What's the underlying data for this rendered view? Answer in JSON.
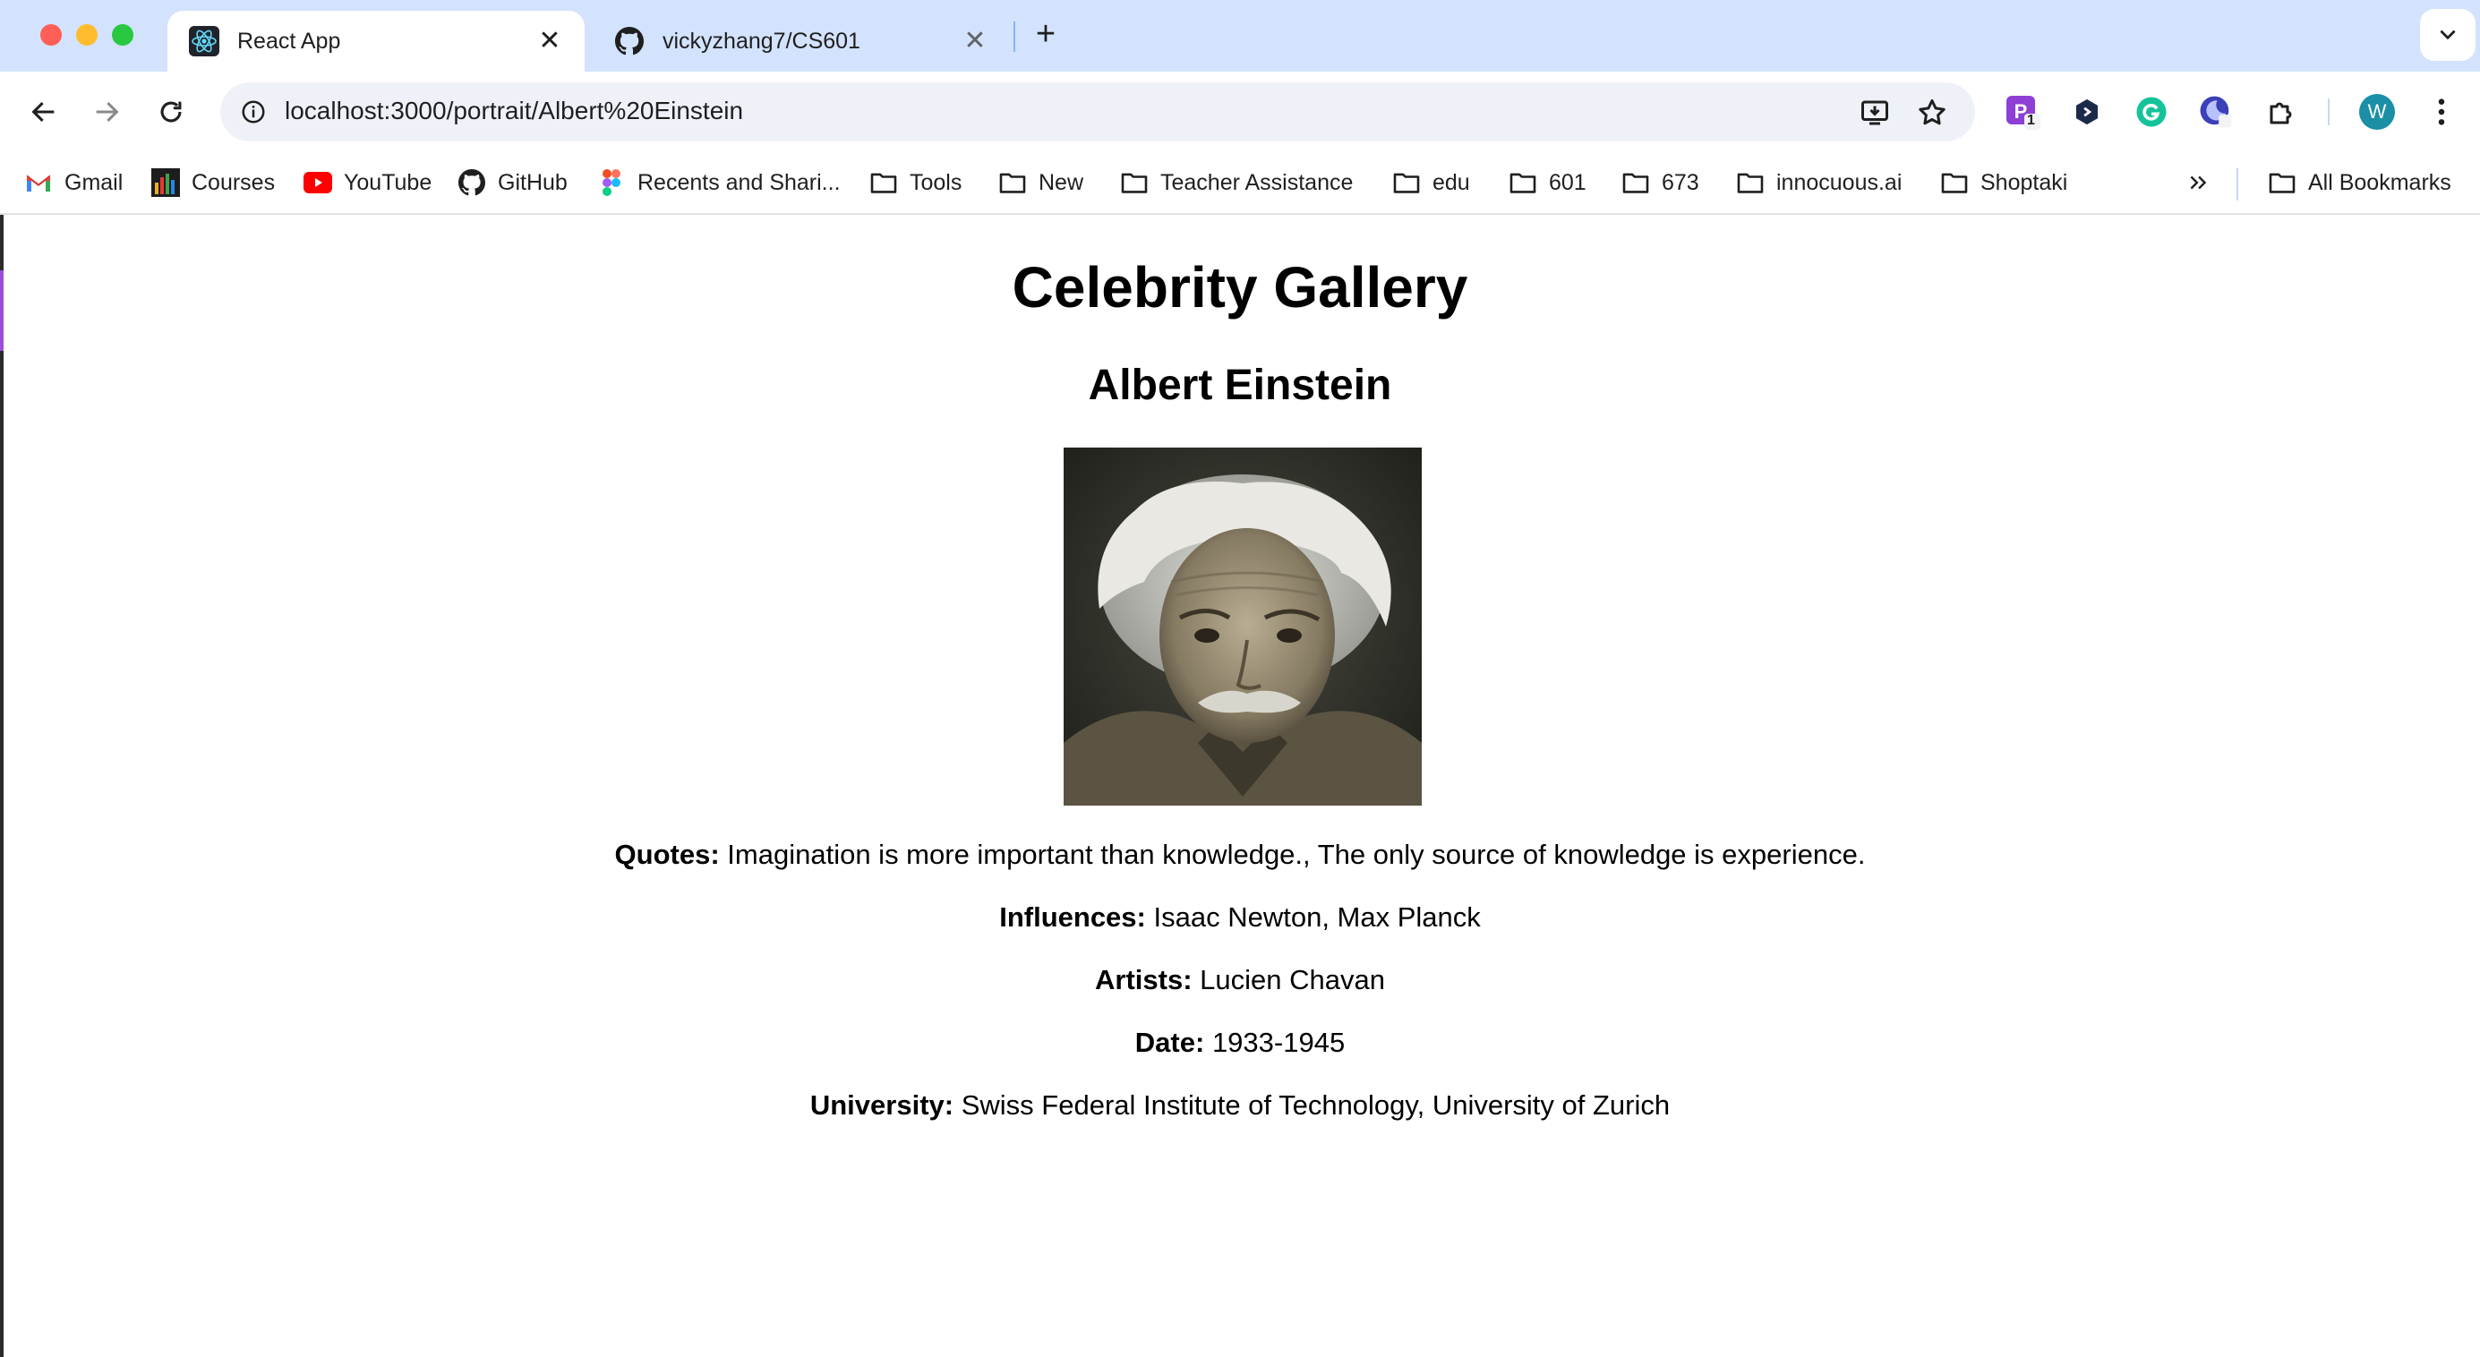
{
  "window": {
    "tabs": [
      {
        "title": "React App",
        "active": true,
        "icon": "react-icon"
      },
      {
        "title": "vickyzhang7/CS601",
        "active": false,
        "icon": "github-icon"
      }
    ]
  },
  "toolbar": {
    "url": "localhost:3000/portrait/Albert%20Einstein",
    "profile_initial": "W",
    "extension_badge": "1"
  },
  "bookmarks": {
    "items": [
      {
        "label": "Gmail",
        "icon": "gmail-icon"
      },
      {
        "label": "Courses",
        "icon": "courses-icon"
      },
      {
        "label": "YouTube",
        "icon": "youtube-icon"
      },
      {
        "label": "GitHub",
        "icon": "github-icon"
      },
      {
        "label": "Recents and Shari...",
        "icon": "figma-icon"
      },
      {
        "label": "Tools",
        "icon": "folder-icon"
      },
      {
        "label": "New",
        "icon": "folder-icon"
      },
      {
        "label": "Teacher Assistance",
        "icon": "folder-icon"
      },
      {
        "label": "edu",
        "icon": "folder-icon"
      },
      {
        "label": "601",
        "icon": "folder-icon"
      },
      {
        "label": "673",
        "icon": "folder-icon"
      },
      {
        "label": "innocuous.ai",
        "icon": "folder-icon"
      },
      {
        "label": "Shoptaki",
        "icon": "folder-icon"
      }
    ],
    "all_bookmarks": "All Bookmarks"
  },
  "page": {
    "title": "Celebrity Gallery",
    "name": "Albert Einstein",
    "details": [
      {
        "label": "Quotes:",
        "value": "Imagination is more important than knowledge., The only source of knowledge is experience."
      },
      {
        "label": "Influences:",
        "value": "Isaac Newton, Max Planck"
      },
      {
        "label": "Artists:",
        "value": "Lucien Chavan"
      },
      {
        "label": "Date:",
        "value": "1933-1945"
      },
      {
        "label": "University:",
        "value": "Swiss Federal Institute of Technology, University of Zurich"
      }
    ]
  },
  "colors": {
    "tabstrip": "#d3e3fd",
    "omnibox": "#eef2f8",
    "profile": "#1a8fa6"
  }
}
